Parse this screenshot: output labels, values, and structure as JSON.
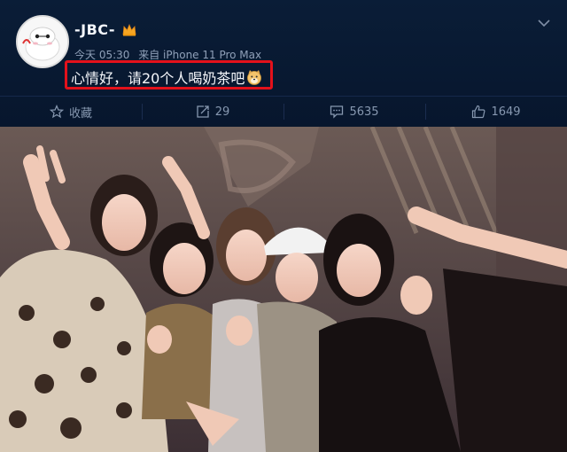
{
  "post": {
    "username": "-JBC-",
    "badge_icon": "crown-icon",
    "menu_icon": "chevron-down-icon",
    "time": "今天 05:30",
    "source": "来自 iPhone 11 Pro Max",
    "text": "心情好，请20个人喝奶茶吧",
    "emoji_icon": "doge-emoji-icon"
  },
  "actions": [
    {
      "icon": "star-icon",
      "label": "收藏"
    },
    {
      "icon": "repost-icon",
      "label": "29"
    },
    {
      "icon": "comment-icon",
      "label": "5635"
    },
    {
      "icon": "like-icon",
      "label": "1649"
    }
  ],
  "colors": {
    "background": "#07162d",
    "highlight_box": "#e3111b",
    "muted_text": "#8fa0b8"
  }
}
